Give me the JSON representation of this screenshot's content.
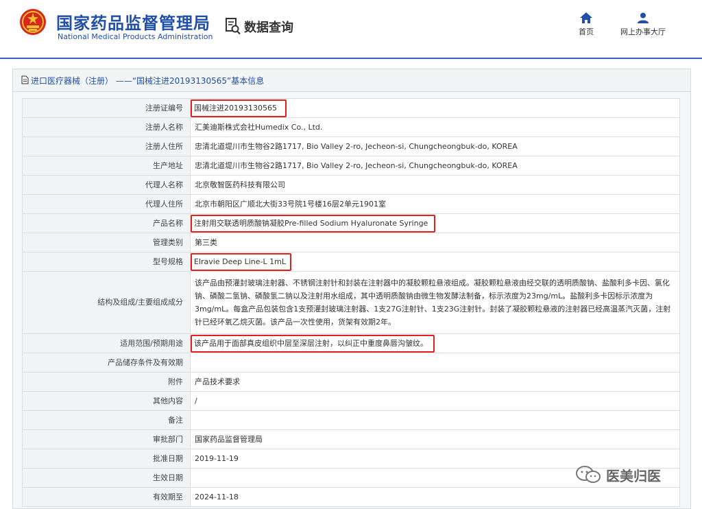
{
  "header": {
    "brand_cn": "国家药品监督管理局",
    "brand_en": "National Medical Products Administration",
    "data_query": "数据查询",
    "nav": {
      "home": "首页",
      "service_hall": "网上办事大厅"
    },
    "accent_color": "#1f4fa8",
    "icons": [
      "emblem-icon",
      "document-search-icon",
      "home-icon",
      "user-icon"
    ]
  },
  "panel": {
    "title": "进口医疗器械（注册） ——“国械注进20193130565”基本信息",
    "title_icon": "document-icon"
  },
  "rows": [
    {
      "label": "注册证编号",
      "value": "国械注进20193130565",
      "highlight": true
    },
    {
      "label": "注册人名称",
      "value": "汇美迪斯株式会社Humedix Co., Ltd."
    },
    {
      "label": "注册人住所",
      "value": "忠清北道堤川市生物谷2路1717, Bio Valley 2-ro, Jecheon-si, Chungcheongbuk-do, KOREA"
    },
    {
      "label": "生产地址",
      "value": "忠清北道堤川市生物谷2路1717, Bio Valley 2-ro, Jecheon-si, Chungcheongbuk-do, KOREA"
    },
    {
      "label": "代理人名称",
      "value": "北京敬智医药科技有限公司"
    },
    {
      "label": "代理人住所",
      "value": "北京市朝阳区广顺北大街33号院1号楼16层2单元1901室"
    },
    {
      "label": "产品名称",
      "value": "注射用交联透明质酸钠凝胶Pre-filled Sodium Hyaluronate Syringe",
      "highlight": true
    },
    {
      "label": "管理类别",
      "value": "第三类"
    },
    {
      "label": "型号规格",
      "value": "Elravie Deep Line-L 1mL",
      "highlight": true
    },
    {
      "label": "结构及组成/主要组成成分",
      "value": "该产品由预灌封玻璃注射器、不锈钢注射针和封装在注射器中的凝胶颗粒悬液组成。凝胶颗粒悬液由经交联的透明质酸钠、盐酸利多卡因、氯化钠、磷酸二氢钠、磷酸氢二钠以及注射用水组成，其中透明质酸钠由微生物发酵法制备，标示浓度为23mg/mL。盐酸利多卡因标示浓度为3mg/mL。每盒产品包装包含1支预灌封玻璃注射器、1支27G注射针、1支23G注射针。封装了凝胶颗粒悬液的注射器已经高温蒸汽灭菌，注射针已经环氧乙烷灭菌。该产品一次性使用，货架有效期2年。"
    },
    {
      "label": "适用范围/预期用途",
      "value": "该产品用于面部真皮组织中层至深层注射，以纠正中重度鼻唇沟皱纹。",
      "highlight": true
    },
    {
      "label": "产品储存条件及有效期",
      "value": ""
    },
    {
      "label": "附件",
      "value": "产品技术要求"
    },
    {
      "label": "其他内容",
      "value": "/"
    },
    {
      "label": "备注",
      "value": ""
    },
    {
      "label": "审批部门",
      "value": "国家药品监督管理局"
    },
    {
      "label": "批准日期",
      "value": "2019-11-19"
    },
    {
      "label": "生效日期",
      "value": ""
    },
    {
      "label": "有效期至",
      "value": "2024-11-18"
    }
  ],
  "watermark": {
    "text": "医美归医",
    "icon": "wechat-icon"
  }
}
